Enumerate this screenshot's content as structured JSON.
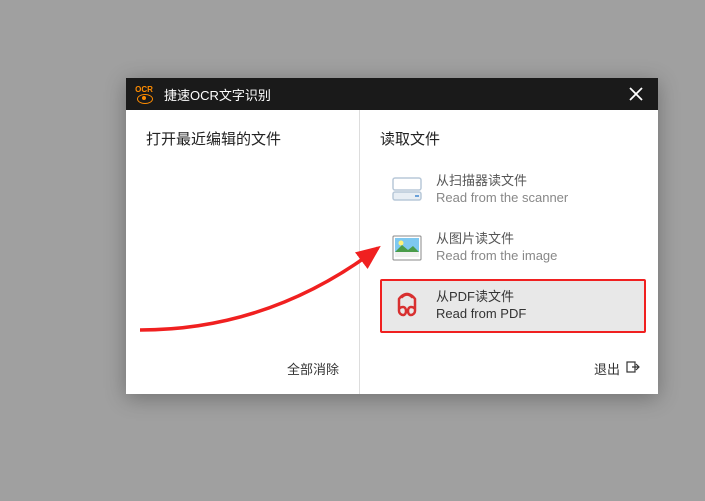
{
  "titlebar": {
    "logo_text": "OCR",
    "title": "捷速OCR文字识别"
  },
  "left": {
    "title": "打开最近编辑的文件",
    "clear_all": "全部消除"
  },
  "right": {
    "title": "读取文件",
    "options": [
      {
        "cn": "从扫描器读文件",
        "en": "Read from the scanner"
      },
      {
        "cn": "从图片读文件",
        "en": "Read from the image"
      },
      {
        "cn": "从PDF读文件",
        "en": "Read from PDF"
      }
    ],
    "exit": "退出"
  }
}
